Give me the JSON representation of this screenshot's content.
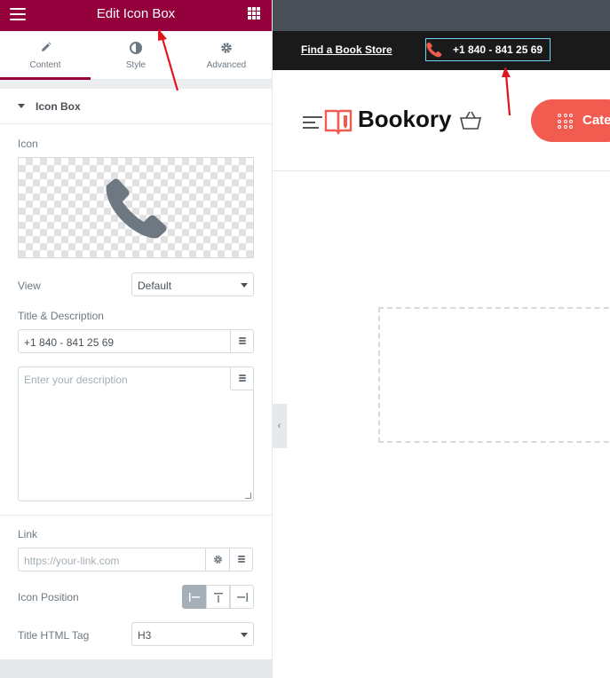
{
  "panel": {
    "title": "Edit Icon Box",
    "tabs": [
      {
        "label": "Content",
        "icon": "pencil-icon"
      },
      {
        "label": "Style",
        "icon": "half-circle-icon"
      },
      {
        "label": "Advanced",
        "icon": "gear-icon"
      }
    ],
    "section_title": "Icon Box",
    "icon_label": "Icon",
    "view_label": "View",
    "view_value": "Default",
    "title_desc_label": "Title & Description",
    "title_value": "+1 840 - 841 25 69",
    "description_placeholder": "Enter your description",
    "link_label": "Link",
    "link_placeholder": "https://your-link.com",
    "icon_position_label": "Icon Position",
    "title_tag_label": "Title HTML Tag",
    "title_tag_value": "H3"
  },
  "preview": {
    "find_store": "Find a Book Store",
    "phone": "+1 840 - 841 25 69",
    "logo": "Bookory",
    "categories": "Cate"
  },
  "colors": {
    "brand": "#93003c",
    "accent": "#f25b4f",
    "top_bar": "#1a1a1a",
    "annotation_arrow": "#e0141e"
  }
}
